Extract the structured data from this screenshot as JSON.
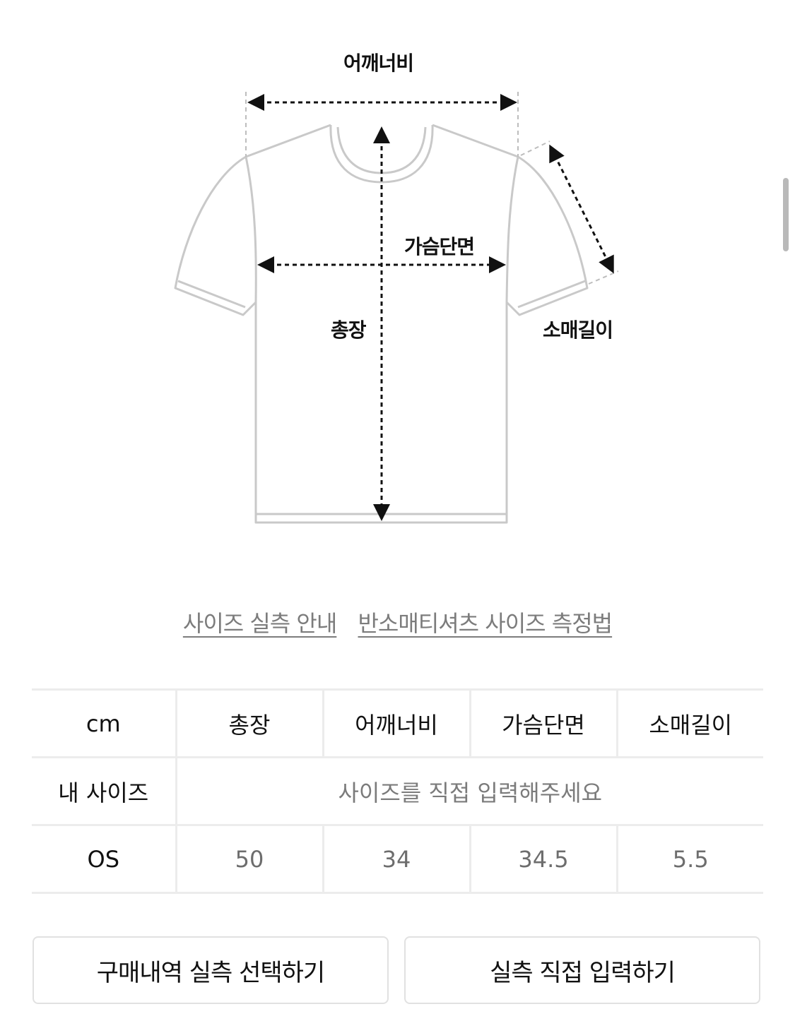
{
  "diagram": {
    "labels": {
      "shoulder": "어깨너비",
      "chest": "가슴단면",
      "length": "총장",
      "sleeve": "소매길이"
    }
  },
  "links": [
    {
      "label": "사이즈 실측 안내"
    },
    {
      "label": "반소매티셔츠 사이즈 측정법"
    }
  ],
  "table": {
    "unit": "cm",
    "headers": [
      "총장",
      "어깨너비",
      "가슴단면",
      "소매길이"
    ],
    "my_size_label": "내 사이즈",
    "my_size_hint": "사이즈를 직접 입력해주세요",
    "rows": [
      {
        "size": "OS",
        "values": [
          "50",
          "34",
          "34.5",
          "5.5"
        ]
      }
    ]
  },
  "buttons": {
    "purchase_history": "구매내역 실측 선택하기",
    "manual_input": "실측 직접 입력하기"
  }
}
